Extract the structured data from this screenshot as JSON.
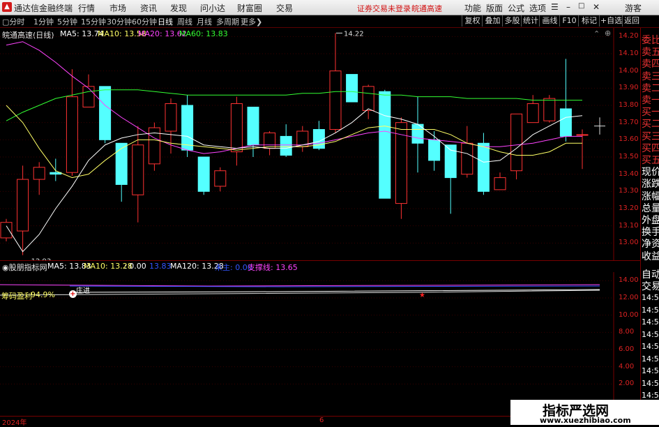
{
  "app": {
    "title": "通达信金融终端",
    "menu": [
      "行情",
      "市场",
      "资讯",
      "发现",
      "问小达",
      "财富圈",
      "交易"
    ],
    "notice": "证券交易未登录",
    "stock_link": "皖通高速",
    "right_menu": [
      "功能",
      "版面",
      "公式",
      "选项"
    ],
    "guest": "游客"
  },
  "toolbar": {
    "periods": [
      "分时",
      "1分钟",
      "5分钟",
      "15分钟",
      "30分钟",
      "60分钟",
      "日线",
      "周线",
      "月线",
      "多周期",
      "更多"
    ],
    "selected": "日线",
    "right_buttons": [
      "复权",
      "叠加",
      "多股",
      "统计",
      "画线",
      "F10",
      "标记",
      "+自选",
      "返回"
    ]
  },
  "main_chart": {
    "title": "皖通高速(日线)",
    "ma": [
      {
        "label": "MA5: 13.74",
        "color": "#ffffff"
      },
      {
        "label": "MA10: 13.58",
        "color": "#ffff66"
      },
      {
        "label": "MA20: 13.62",
        "color": "#ff44ff"
      },
      {
        "label": "MA60: 13.83",
        "color": "#33ff33"
      }
    ],
    "high_label": "14.22",
    "low_label": "12.93",
    "yticks": [
      "14.20",
      "14.10",
      "14.00",
      "13.90",
      "13.80",
      "13.70",
      "13.60",
      "13.50",
      "13.40",
      "13.30",
      "13.20",
      "13.10",
      "13.00"
    ]
  },
  "sub_chart": {
    "title": "股朋指标网",
    "items": [
      {
        "label": "MA5: 13.83",
        "color": "#ffffff"
      },
      {
        "label": "MA10: 13.28",
        "color": "#ffff66"
      },
      {
        "label": ": 0.00",
        "color": "#ffffff"
      },
      {
        "label": "13.83",
        "color": "#3355ff"
      },
      {
        "label": "MA120: 13.28",
        "color": "#ffffff"
      },
      {
        "label": "未主: 0.00",
        "color": "#3355ff"
      },
      {
        "label": "支撑线: 13.65",
        "color": "#ff44ff"
      }
    ],
    "chip_label": "筹码盈利",
    "chip_value": "94.9%",
    "marker_label": "庄进",
    "yticks": [
      "14.00",
      "12.00",
      "10.00",
      "8.00",
      "6.00",
      "4.00",
      "2.00"
    ]
  },
  "right_tabs": {
    "top": [
      "委比",
      "卖五",
      "卖四",
      "卖三",
      "卖二",
      "卖一",
      "买一",
      "买二",
      "买三",
      "买四",
      "买五",
      "现价",
      "涨跌",
      "涨幅",
      "总量",
      "外盘",
      "换手",
      "净资",
      "收益"
    ],
    "lower": [
      "自动",
      "交易"
    ],
    "times": [
      "14:5",
      "14:5",
      "14:5",
      "14:5",
      "14:5",
      "14:5",
      "14:5",
      "14:5",
      "14:5",
      "14:5"
    ]
  },
  "bottom": {
    "year": "2024年",
    "month": "6"
  },
  "watermark": {
    "title": "指标严选网",
    "url": "www.xuezhibiao.com"
  },
  "chart_data": {
    "type": "candlestick",
    "ylim": [
      12.9,
      14.25
    ],
    "candles": [
      {
        "o": 13.03,
        "c": 13.12,
        "h": 13.14,
        "l": 13.01
      },
      {
        "o": 13.07,
        "c": 13.37,
        "h": 13.45,
        "l": 12.93
      },
      {
        "o": 13.37,
        "c": 13.44,
        "h": 13.47,
        "l": 13.28
      },
      {
        "o": 13.41,
        "c": 13.4,
        "h": 13.49,
        "l": 13.36
      },
      {
        "o": 13.41,
        "c": 13.85,
        "h": 14.01,
        "l": 13.39
      },
      {
        "o": 13.79,
        "c": 13.91,
        "h": 13.98,
        "l": 13.79
      },
      {
        "o": 13.91,
        "c": 13.6,
        "h": 13.91,
        "l": 13.58
      },
      {
        "o": 13.58,
        "c": 13.34,
        "h": 13.58,
        "l": 13.24
      },
      {
        "o": 13.28,
        "c": 13.57,
        "h": 13.68,
        "l": 13.12
      },
      {
        "o": 13.46,
        "c": 13.67,
        "h": 13.7,
        "l": 13.42
      },
      {
        "o": 13.65,
        "c": 13.81,
        "h": 13.84,
        "l": 13.52
      },
      {
        "o": 13.8,
        "c": 13.54,
        "h": 13.86,
        "l": 13.5
      },
      {
        "o": 13.5,
        "c": 13.3,
        "h": 13.5,
        "l": 13.28
      },
      {
        "o": 13.33,
        "c": 13.42,
        "h": 13.44,
        "l": 13.3
      },
      {
        "o": 13.53,
        "c": 13.81,
        "h": 13.85,
        "l": 13.45
      },
      {
        "o": 13.79,
        "c": 13.57,
        "h": 13.79,
        "l": 13.5
      },
      {
        "o": 13.55,
        "c": 13.64,
        "h": 13.65,
        "l": 13.51
      },
      {
        "o": 13.62,
        "c": 13.51,
        "h": 13.69,
        "l": 13.5
      },
      {
        "o": 13.56,
        "c": 13.65,
        "h": 13.68,
        "l": 13.53
      },
      {
        "o": 13.66,
        "c": 13.55,
        "h": 13.71,
        "l": 13.54
      },
      {
        "o": 13.66,
        "c": 14.0,
        "h": 14.22,
        "l": 13.64
      },
      {
        "o": 13.98,
        "c": 13.82,
        "h": 13.98,
        "l": 13.82
      },
      {
        "o": 13.77,
        "c": 13.91,
        "h": 13.92,
        "l": 13.72
      },
      {
        "o": 13.88,
        "c": 13.26,
        "h": 13.89,
        "l": 13.26
      },
      {
        "o": 13.23,
        "c": 13.7,
        "h": 13.73,
        "l": 13.14
      },
      {
        "o": 13.69,
        "c": 13.58,
        "h": 13.85,
        "l": 13.41
      },
      {
        "o": 13.6,
        "c": 13.48,
        "h": 13.65,
        "l": 13.42
      },
      {
        "o": 13.57,
        "c": 13.38,
        "h": 13.57,
        "l": 13.17
      },
      {
        "o": 13.4,
        "c": 13.58,
        "h": 13.68,
        "l": 13.38
      },
      {
        "o": 13.58,
        "c": 13.3,
        "h": 13.64,
        "l": 13.28
      },
      {
        "o": 13.31,
        "c": 13.38,
        "h": 13.41,
        "l": 13.31
      },
      {
        "o": 13.42,
        "c": 13.75,
        "h": 13.75,
        "l": 13.37
      },
      {
        "o": 13.7,
        "c": 13.81,
        "h": 13.86,
        "l": 13.72
      },
      {
        "o": 13.71,
        "c": 13.84,
        "h": 13.86,
        "l": 13.7
      },
      {
        "o": 13.78,
        "c": 13.62,
        "h": 14.07,
        "l": 13.59
      },
      {
        "o": 13.63,
        "c": 13.63,
        "h": 13.66,
        "l": 13.43
      }
    ],
    "ma5": [
      13.1,
      12.95,
      13.05,
      13.2,
      13.33,
      13.48,
      13.57,
      13.61,
      13.63,
      13.64,
      13.63,
      13.62,
      13.57,
      13.56,
      13.55,
      13.56,
      13.55,
      13.55,
      13.57,
      13.59,
      13.64,
      13.7,
      13.78,
      13.74,
      13.72,
      13.69,
      13.62,
      13.54,
      13.52,
      13.47,
      13.48,
      13.55,
      13.63,
      13.68,
      13.73,
      13.74
    ],
    "ma10": [
      13.8,
      13.7,
      13.55,
      13.42,
      13.38,
      13.4,
      13.48,
      13.55,
      13.6,
      13.6,
      13.58,
      13.57,
      13.56,
      13.55,
      13.54,
      13.55,
      13.56,
      13.56,
      13.56,
      13.57,
      13.59,
      13.63,
      13.67,
      13.68,
      13.66,
      13.66,
      13.66,
      13.63,
      13.58,
      13.56,
      13.53,
      13.51,
      13.51,
      13.53,
      13.58,
      13.58
    ],
    "ma20": [
      14.15,
      14.17,
      14.12,
      14.05,
      13.97,
      13.9,
      13.8,
      13.73,
      13.67,
      13.61,
      13.57,
      13.54,
      13.52,
      13.53,
      13.55,
      13.57,
      13.57,
      13.57,
      13.57,
      13.58,
      13.6,
      13.62,
      13.64,
      13.65,
      13.63,
      13.61,
      13.6,
      13.59,
      13.58,
      13.56,
      13.56,
      13.57,
      13.58,
      13.6,
      13.62,
      13.62
    ],
    "ma60": [
      13.71,
      13.76,
      13.8,
      13.84,
      13.86,
      13.88,
      13.89,
      13.89,
      13.89,
      13.88,
      13.87,
      13.86,
      13.86,
      13.86,
      13.86,
      13.86,
      13.86,
      13.86,
      13.87,
      13.87,
      13.88,
      13.88,
      13.87,
      13.86,
      13.86,
      13.85,
      13.85,
      13.85,
      13.84,
      13.84,
      13.84,
      13.84,
      13.83,
      13.83,
      13.83,
      13.83
    ]
  }
}
